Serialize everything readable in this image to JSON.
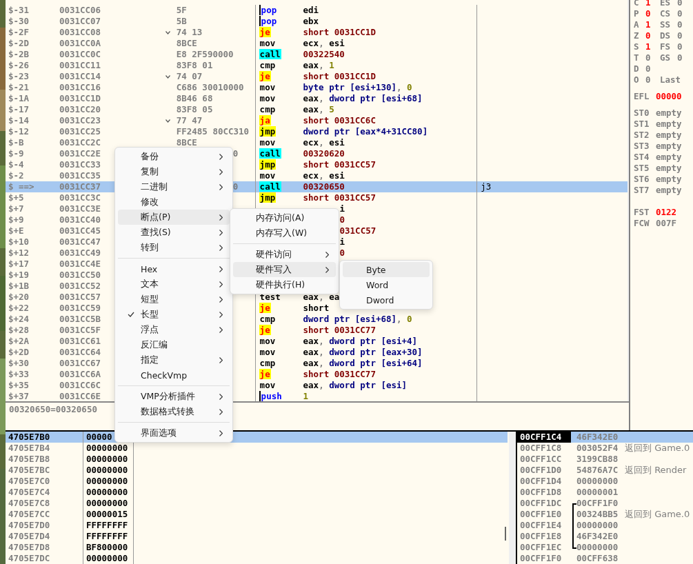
{
  "disassembly": {
    "rows": [
      {
        "offset": "$-31",
        "address": "0031CC06",
        "bytes": "5F",
        "mnemonic": "pop",
        "kind": "stack",
        "operand": "edi",
        "jump": false,
        "selected": false
      },
      {
        "offset": "$-30",
        "address": "0031CC07",
        "bytes": "5B",
        "mnemonic": "pop",
        "kind": "stack",
        "operand": "ebx",
        "jump": false,
        "selected": false
      },
      {
        "offset": "$-2F",
        "address": "0031CC08",
        "bytes": "74 13",
        "mnemonic": "je",
        "kind": "jcc",
        "operand": "short 0031CC1D",
        "jump": true,
        "selected": false
      },
      {
        "offset": "$-2D",
        "address": "0031CC0A",
        "bytes": "8BCE",
        "mnemonic": "mov",
        "kind": "plain",
        "operand": "ecx, esi",
        "jump": false,
        "selected": false
      },
      {
        "offset": "$-2B",
        "address": "0031CC0C",
        "bytes": "E8 2F590000",
        "mnemonic": "call",
        "kind": "call",
        "operand": "00322540",
        "jump": false,
        "selected": false
      },
      {
        "offset": "$-26",
        "address": "0031CC11",
        "bytes": "83F8 01",
        "mnemonic": "cmp",
        "kind": "plain",
        "operand": "eax, 1",
        "jump": false,
        "selected": false
      },
      {
        "offset": "$-23",
        "address": "0031CC14",
        "bytes": "74 07",
        "mnemonic": "je",
        "kind": "jcc",
        "operand": "short 0031CC1D",
        "jump": true,
        "selected": false
      },
      {
        "offset": "$-21",
        "address": "0031CC16",
        "bytes": "C686 30010000",
        "mnemonic": "mov",
        "kind": "plain",
        "operand": "byte ptr [esi+130], 0",
        "jump": false,
        "selected": false
      },
      {
        "offset": "$-1A",
        "address": "0031CC1D",
        "bytes": "8B46 68",
        "mnemonic": "mov",
        "kind": "plain",
        "operand": "eax, dword ptr [esi+68]",
        "jump": false,
        "selected": false
      },
      {
        "offset": "$-17",
        "address": "0031CC20",
        "bytes": "83F8 05",
        "mnemonic": "cmp",
        "kind": "plain",
        "operand": "eax, 5",
        "jump": false,
        "selected": false
      },
      {
        "offset": "$-14",
        "address": "0031CC23",
        "bytes": "77 47",
        "mnemonic": "ja",
        "kind": "jcc",
        "operand": "short 0031CC6C",
        "jump": true,
        "selected": false
      },
      {
        "offset": "$-12",
        "address": "0031CC25",
        "bytes": "FF2485 80CC310",
        "mnemonic": "jmp",
        "kind": "jmp",
        "operand": "dword ptr [eax*4+31CC80]",
        "jump": false,
        "selected": false
      },
      {
        "offset": "$-B",
        "address": "0031CC2C",
        "bytes": "8BCE",
        "mnemonic": "mov",
        "kind": "plain",
        "operand": "ecx, esi",
        "jump": false,
        "selected": false
      },
      {
        "offset": "$-9",
        "address": "0031CC2E",
        "bytes": "0",
        "bytes_clipped": true,
        "mnemonic": "call",
        "kind": "call",
        "operand": "00320620",
        "selected": false
      },
      {
        "offset": "$-4",
        "address": "0031CC33",
        "mnemonic": "jmp",
        "kind": "jmp",
        "operand": "short 0031CC57",
        "selected": false
      },
      {
        "offset": "$-2",
        "address": "0031CC35",
        "mnemonic": "mov",
        "kind": "plain",
        "operand": "ecx, esi",
        "selected": false
      },
      {
        "offset": "$ ==>",
        "address": "0031CC37",
        "bytes": "0",
        "bytes_clipped": true,
        "mnemonic": "call",
        "kind": "call",
        "operand": "00320650",
        "comment": "j3",
        "selected": true
      },
      {
        "offset": "$+5",
        "address": "0031CC3C",
        "mnemonic": "jmp",
        "kind": "jmp",
        "operand": "short 0031CC57",
        "selected": false
      },
      {
        "offset": "$+7",
        "address": "0031CC3E",
        "operand": "i",
        "operand_clipped": true,
        "selected": false
      },
      {
        "offset": "$+9",
        "address": "0031CC40",
        "operand": "0",
        "operand_clipped": true,
        "selected": false
      },
      {
        "offset": "$+E",
        "address": "0031CC45",
        "operand": "031CC57",
        "operand_clipped": true,
        "selected": false
      },
      {
        "offset": "$+10",
        "address": "0031CC47",
        "operand": "i",
        "operand_clipped": true,
        "selected": false
      },
      {
        "offset": "$+12",
        "address": "0031CC49",
        "operand": "0",
        "operand_clipped": true,
        "selected": false
      },
      {
        "offset": "$+17",
        "address": "0031CC4E",
        "selected": false
      },
      {
        "offset": "$+19",
        "address": "0031CC50",
        "selected": false
      },
      {
        "offset": "$+1B",
        "address": "0031CC52",
        "selected": false
      },
      {
        "offset": "$+20",
        "address": "0031CC57",
        "mnemonic": "test",
        "kind": "plain",
        "operand": "eax, ea",
        "selected": false
      },
      {
        "offset": "$+22",
        "address": "0031CC59",
        "mnemonic": "je",
        "kind": "jcc",
        "operand": "short",
        "selected": false
      },
      {
        "offset": "$+24",
        "address": "0031CC5B",
        "mnemonic": "cmp",
        "kind": "plain",
        "operand": "dword ptr [esi+68], 0",
        "selected": false
      },
      {
        "offset": "$+28",
        "address": "0031CC5F",
        "mnemonic": "je",
        "kind": "jcc",
        "operand": "short 0031CC77",
        "selected": false
      },
      {
        "offset": "$+2A",
        "address": "0031CC61",
        "mnemonic": "mov",
        "kind": "plain",
        "operand": "eax, dword ptr [esi+4]",
        "selected": false
      },
      {
        "offset": "$+2D",
        "address": "0031CC64",
        "mnemonic": "mov",
        "kind": "plain",
        "operand": "eax, dword ptr [eax+30]",
        "selected": false
      },
      {
        "offset": "$+30",
        "address": "0031CC67",
        "mnemonic": "cmp",
        "kind": "plain",
        "operand": "eax, dword ptr [esi+64]",
        "selected": false
      },
      {
        "offset": "$+33",
        "address": "0031CC6A",
        "mnemonic": "je",
        "kind": "jcc",
        "operand": "short 0031CC77",
        "selected": false
      },
      {
        "offset": "$+35",
        "address": "0031CC6C",
        "mnemonic": "mov",
        "kind": "plain",
        "operand": "eax, dword ptr [esi]",
        "selected": false
      },
      {
        "offset": "$+37",
        "address": "0031CC6E",
        "mnemonic": "push",
        "kind": "stack",
        "operand": "1",
        "selected": false
      }
    ]
  },
  "info_line": "00320650=00320650",
  "registers": {
    "flags": [
      {
        "name": "C",
        "value": "1",
        "changed": true,
        "segment": "ES",
        "segment_value": "0"
      },
      {
        "name": "P",
        "value": "0",
        "changed": true,
        "segment": "CS",
        "segment_value": "0"
      },
      {
        "name": "A",
        "value": "1",
        "changed": true,
        "segment": "SS",
        "segment_value": "0"
      },
      {
        "name": "Z",
        "value": "0",
        "changed": true,
        "segment": "DS",
        "segment_value": "0"
      },
      {
        "name": "S",
        "value": "1",
        "changed": true,
        "segment": "FS",
        "segment_value": "0"
      },
      {
        "name": "T",
        "value": "0",
        "changed": false,
        "segment": "GS",
        "segment_value": "0"
      },
      {
        "name": "D",
        "value": "0",
        "changed": false
      },
      {
        "name": "O",
        "value": "0",
        "changed": false,
        "segment": "Last"
      }
    ],
    "efl": {
      "name": "EFL",
      "value": "00000",
      "changed": true
    },
    "fpu": [
      {
        "name": "ST0",
        "value": "empty"
      },
      {
        "name": "ST1",
        "value": "empty"
      },
      {
        "name": "ST2",
        "value": "empty"
      },
      {
        "name": "ST3",
        "value": "empty"
      },
      {
        "name": "ST4",
        "value": "empty"
      },
      {
        "name": "ST5",
        "value": "empty"
      },
      {
        "name": "ST6",
        "value": "empty"
      },
      {
        "name": "ST7",
        "value": "empty"
      }
    ],
    "status": [
      {
        "name": "FST",
        "value": "0122",
        "changed": true
      },
      {
        "name": "FCW",
        "value": "007F",
        "changed": false
      }
    ]
  },
  "dump": {
    "rows": [
      {
        "address": "4705E7B0",
        "value": "00000",
        "selected": true
      },
      {
        "address": "4705E7B4",
        "value": "00000000",
        "selected": false
      },
      {
        "address": "4705E7B8",
        "value": "00000000",
        "selected": false
      },
      {
        "address": "4705E7BC",
        "value": "00000000",
        "selected": false
      },
      {
        "address": "4705E7C0",
        "value": "00000000",
        "selected": false
      },
      {
        "address": "4705E7C4",
        "value": "00000000",
        "selected": false
      },
      {
        "address": "4705E7C8",
        "value": "00000000",
        "selected": false
      },
      {
        "address": "4705E7CC",
        "value": "00000015",
        "selected": false
      },
      {
        "address": "4705E7D0",
        "value": "FFFFFFFF",
        "selected": false
      },
      {
        "address": "4705E7D4",
        "value": "FFFFFFFF",
        "selected": false
      },
      {
        "address": "4705E7D8",
        "value": "BF800000",
        "selected": false
      },
      {
        "address": "4705E7DC",
        "value": "00000000",
        "selected": false
      }
    ]
  },
  "stack": {
    "rows": [
      {
        "address": "00CFF1C4",
        "value": "46F342E0",
        "selected": true,
        "kind": "plain"
      },
      {
        "address": "00CFF1C8",
        "value": "003052F4",
        "comment": "返回到 Game.0",
        "selected": false,
        "kind": "plain"
      },
      {
        "address": "00CFF1CC",
        "value": "3199CB88",
        "selected": false,
        "kind": "plain"
      },
      {
        "address": "00CFF1D0",
        "value": "54876A7C",
        "comment": "返回到 Render",
        "selected": false,
        "kind": "plain"
      },
      {
        "address": "00CFF1D4",
        "value": "00000000",
        "selected": false,
        "kind": "plain"
      },
      {
        "address": "00CFF1D8",
        "value": "00000001",
        "selected": false,
        "kind": "plain"
      },
      {
        "address": "00CFF1DC",
        "value": "00CFF1F0",
        "selected": false,
        "kind": "frame_start"
      },
      {
        "address": "00CFF1E0",
        "value": "00324BB5",
        "comment": "返回到 Game.0",
        "selected": false,
        "kind": "frame_middle"
      },
      {
        "address": "00CFF1E4",
        "value": "00000000",
        "selected": false,
        "kind": "frame_middle"
      },
      {
        "address": "00CFF1E8",
        "value": "46F342E0",
        "selected": false,
        "kind": "frame_middle"
      },
      {
        "address": "00CFF1EC",
        "value": "00000000",
        "selected": false,
        "kind": "frame_end"
      },
      {
        "address": "00CFF1F0",
        "value": "00CFF638",
        "selected": false,
        "kind": "plain"
      }
    ]
  },
  "context_menu": {
    "items": [
      {
        "kind": "item",
        "label": "备份",
        "submenu": true,
        "checked": false,
        "selected": false
      },
      {
        "kind": "item",
        "label": "复制",
        "submenu": true,
        "checked": false,
        "selected": false
      },
      {
        "kind": "item",
        "label": "二进制",
        "submenu": true,
        "checked": false,
        "selected": false
      },
      {
        "kind": "item",
        "label": "修改",
        "submenu": false,
        "checked": false,
        "selected": false
      },
      {
        "kind": "item",
        "label": "断点(P)",
        "submenu": true,
        "checked": false,
        "selected": true
      },
      {
        "kind": "item",
        "label": "查找(S)",
        "submenu": true,
        "checked": false,
        "selected": false
      },
      {
        "kind": "item",
        "label": "转到",
        "submenu": true,
        "checked": false,
        "selected": false
      },
      {
        "kind": "separator"
      },
      {
        "kind": "item",
        "label": "Hex",
        "submenu": true,
        "checked": false,
        "selected": false
      },
      {
        "kind": "item",
        "label": "文本",
        "submenu": true,
        "checked": false,
        "selected": false
      },
      {
        "kind": "item",
        "label": "短型",
        "submenu": true,
        "checked": false,
        "selected": false
      },
      {
        "kind": "item",
        "label": "长型",
        "submenu": true,
        "checked": true,
        "selected": false
      },
      {
        "kind": "item",
        "label": "浮点",
        "submenu": true,
        "checked": false,
        "selected": false
      },
      {
        "kind": "item",
        "label": "反汇编",
        "submenu": false,
        "checked": false,
        "selected": false
      },
      {
        "kind": "item",
        "label": "指定",
        "submenu": true,
        "checked": false,
        "selected": false
      },
      {
        "kind": "item",
        "label": "CheckVmp",
        "submenu": false,
        "checked": false,
        "selected": false
      },
      {
        "kind": "separator"
      },
      {
        "kind": "item",
        "label": "VMP分析插件",
        "submenu": true,
        "checked": false,
        "selected": false
      },
      {
        "kind": "item",
        "label": "数据格式转换",
        "submenu": true,
        "checked": false,
        "selected": false
      },
      {
        "kind": "separator"
      },
      {
        "kind": "item",
        "label": "界面选项",
        "submenu": true,
        "checked": false,
        "selected": false
      }
    ]
  },
  "breakpoint_menu": {
    "items": [
      {
        "kind": "item",
        "label": "内存访问(A)",
        "submenu": false,
        "selected": false
      },
      {
        "kind": "item",
        "label": "内存写入(W)",
        "submenu": false,
        "selected": false
      },
      {
        "kind": "separator"
      },
      {
        "kind": "item",
        "label": "硬件访问",
        "submenu": true,
        "selected": false
      },
      {
        "kind": "item",
        "label": "硬件写入",
        "submenu": true,
        "selected": true
      },
      {
        "kind": "item",
        "label": "硬件执行(H)",
        "submenu": false,
        "selected": false
      }
    ]
  },
  "hardware_write_menu": {
    "items": [
      {
        "kind": "item",
        "label": "Byte",
        "submenu": false,
        "selected": true
      },
      {
        "kind": "item",
        "label": "Word",
        "submenu": false,
        "selected": false
      },
      {
        "kind": "item",
        "label": "Dword",
        "submenu": false,
        "selected": false
      }
    ]
  }
}
